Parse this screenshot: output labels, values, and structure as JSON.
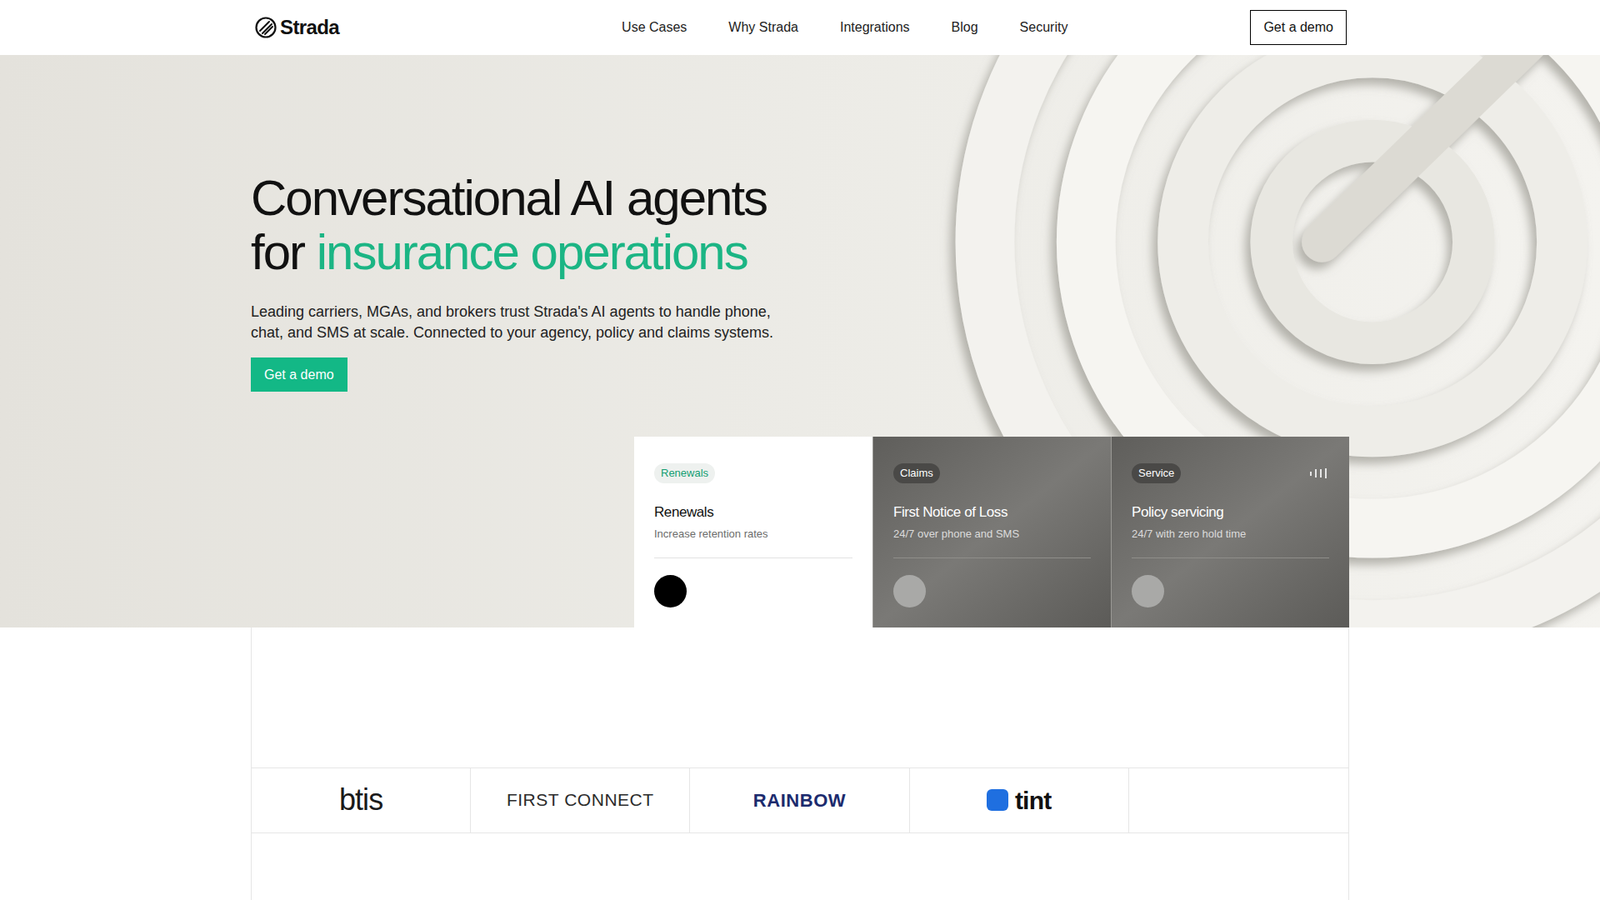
{
  "nav": {
    "logo": "Strada",
    "links": [
      "Use Cases",
      "Why Strada",
      "Integrations",
      "Blog",
      "Security"
    ],
    "cta": "Get a demo"
  },
  "hero": {
    "title_line1": "Conversational AI agents",
    "title_prefix": "for",
    "title_highlight": "insurance operations",
    "description": "Leading carriers, MGAs, and brokers trust Strada's AI agents to handle phone, chat, and SMS at scale. Connected to your agency, policy and claims systems.",
    "cta": "Get a demo"
  },
  "cards": [
    {
      "tag": "Renewals",
      "title": "Renewals",
      "subtitle": "Increase retention rates",
      "selected": true,
      "kind": "plain"
    },
    {
      "tag": "Claims",
      "title": "First Notice of Loss",
      "subtitle": "24/7 over phone and SMS",
      "selected": false,
      "kind": "plain"
    },
    {
      "tag": "Service",
      "title": "Policy servicing",
      "subtitle": "24/7 with zero hold time",
      "selected": false,
      "kind": "audio"
    }
  ],
  "logos": [
    {
      "name": "btis",
      "color": "#1a1a1a"
    },
    {
      "name": "FIRST CONNECT",
      "color": "#2b2b2b"
    },
    {
      "name": "RAINBOW",
      "color": "#1c2b6e"
    },
    {
      "name": "tint",
      "color": "#111111"
    }
  ]
}
